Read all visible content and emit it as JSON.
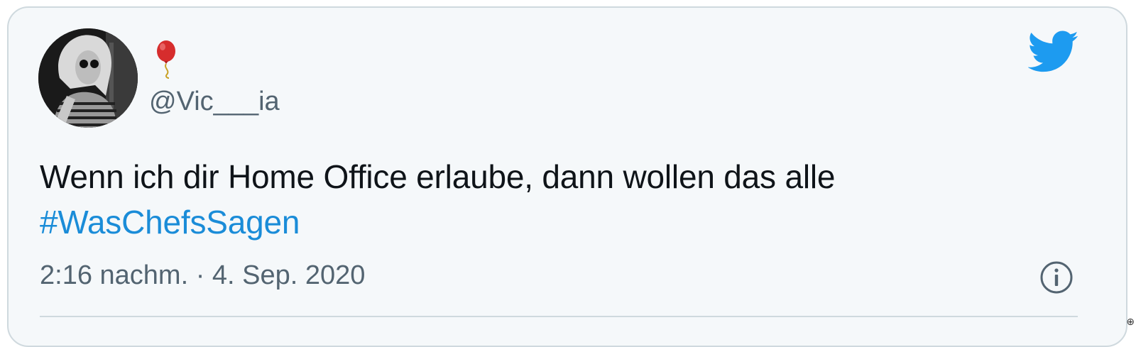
{
  "tweet": {
    "display_name_icon": "balloon-emoji",
    "handle": "@Vic___ia",
    "text_line1": "Wenn ich dir Home Office erlaube, dann wollen das alle",
    "hashtag": "#WasChefsSagen",
    "timestamp": "2:16 nachm. · 4. Sep. 2020"
  },
  "icons": {
    "brand": "twitter-bird-icon",
    "info": "info-icon"
  },
  "colors": {
    "card_background": "#f5f8fa",
    "brand_blue": "#1d9bf0",
    "hashtag_blue": "#1a8cd8",
    "secondary_text": "#536471",
    "primary_text": "#0f1419",
    "balloon_red": "#d62d2d"
  }
}
